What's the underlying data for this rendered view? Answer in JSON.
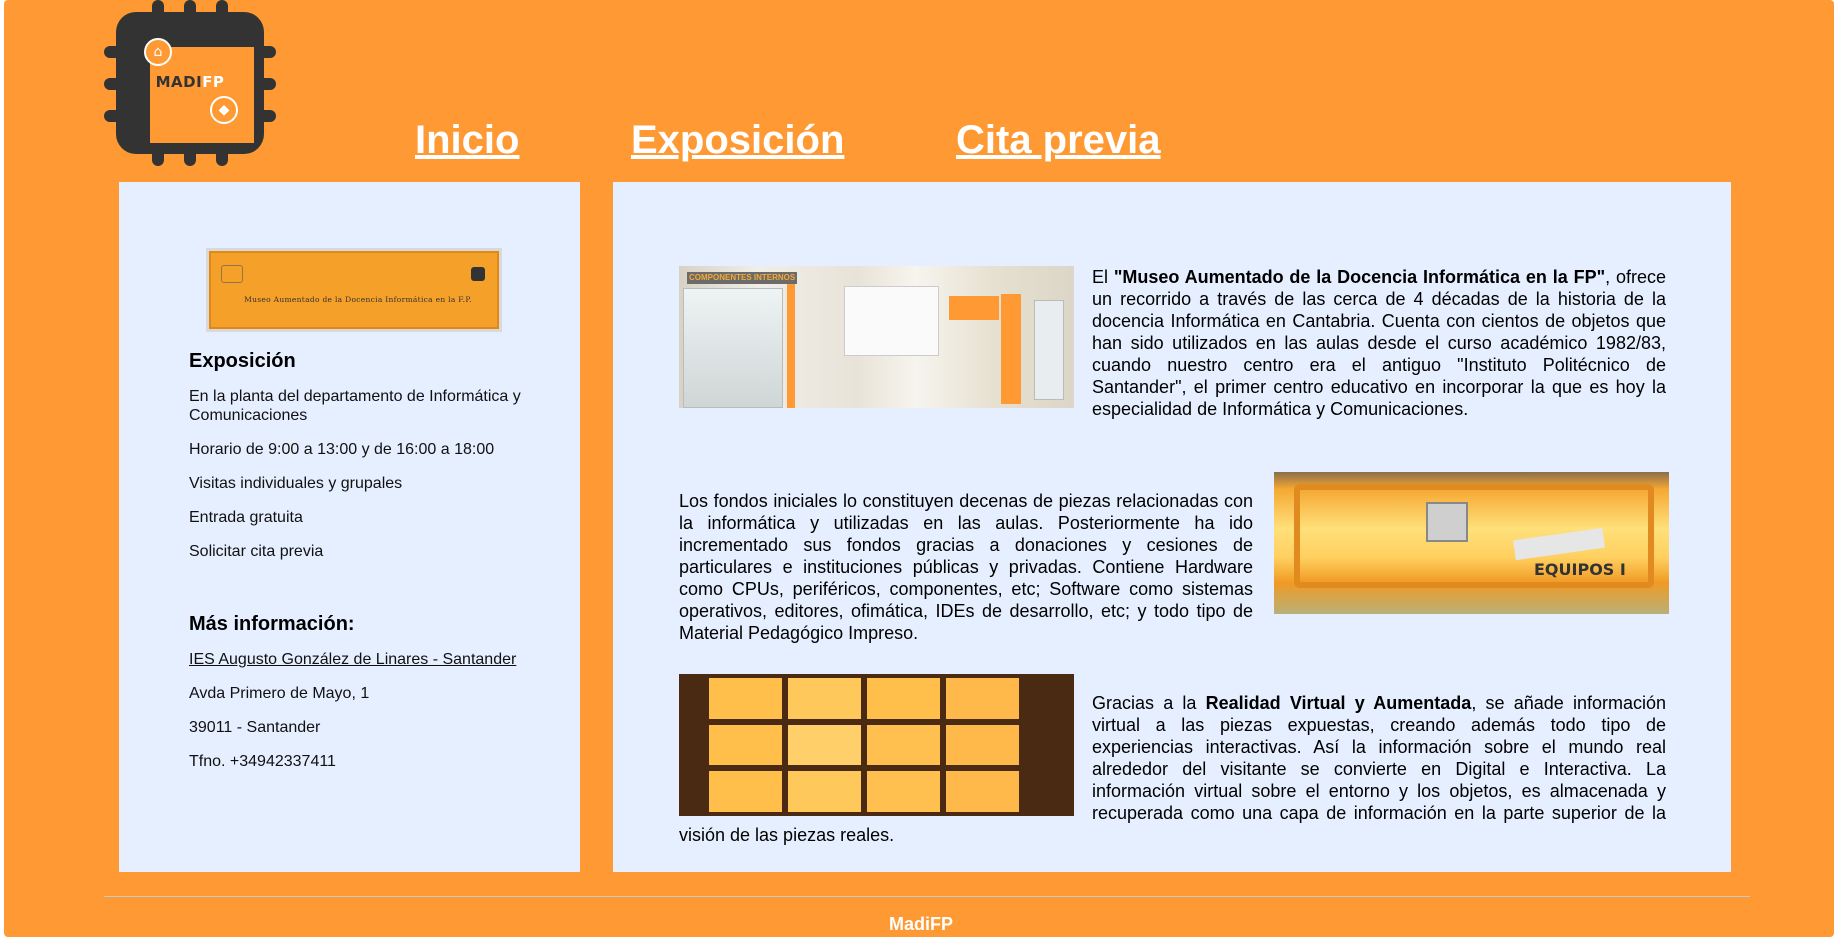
{
  "brand": {
    "logo_text": "MADI",
    "logo_text_fp": "FP"
  },
  "nav": {
    "home": "Inicio",
    "exhibition": "Exposición",
    "appointment": "Cita previa"
  },
  "sidebar": {
    "plaque_text": "Museo Aumentado de la Docencia Informática en la F.P.",
    "expo_title": "Exposición",
    "expo_items": [
      "En la planta del departamento de Informática y Comunicaciones",
      "Horario de 9:00 a 13:00 y de 16:00 a 18:00",
      "Visitas individuales y grupales",
      "Entrada gratuita",
      "Solicitar cita previa"
    ],
    "more_title": "Más información:",
    "school_link": "IES Augusto González de Linares - Santander",
    "address": "Avda Primero de Mayo, 1",
    "city": "39011 - Santander",
    "phone": "Tfno. +34942337411"
  },
  "main": {
    "p1_a": "El ",
    "p1_bold": "\"Museo Aumentado de la Docencia Informática en la FP\"",
    "p1_b": ", ofrece un recorrido a través de las cerca de 4 décadas de la historia de la docencia Informática en Cantabria. Cuenta con cientos de objetos que han sido utilizados en las aulas desde el curso académico 1982/83, cuando nuestro centro era el antiguo \"Instituto Politécnico de Santander\", el primer centro educativo en incorporar la que es hoy la especialidad de Informática y Comunicaciones.",
    "p2": "Los fondos iniciales lo constituyen decenas de piezas relacionadas con la informática y utilizadas en las aulas. Posteriormente ha ido incrementado sus fondos gracias a donaciones y cesiones de particulares e instituciones públicas y privadas. Contiene Hardware como CPUs, periféricos, componentes, etc; Software como sistemas operativos, editores, ofimática, IDEs de desarrollo, etc; y todo tipo de Material Pedagógico Impreso.",
    "p3_a": "Gracias a la ",
    "p3_bold": "Realidad Virtual y Aumentada",
    "p3_b": ", se añade información virtual a las piezas expuestas, creando además todo tipo de experiencias interactivas. Así la información sobre el mundo real alrededor del visitante se convierte en Digital e Interactiva. La información virtual sobre el entorno y los objetos, es almacenada y recuperada como una capa de información en la parte superior de la visión de las piezas reales.",
    "img1_sign": "COMPONENTES INTERNOS",
    "img2_sign": "EQUIPOS I"
  },
  "footer": {
    "text": "MadiFP"
  },
  "colors": {
    "background": "#ff9933",
    "panel": "#e6efff",
    "chip": "#333333"
  }
}
